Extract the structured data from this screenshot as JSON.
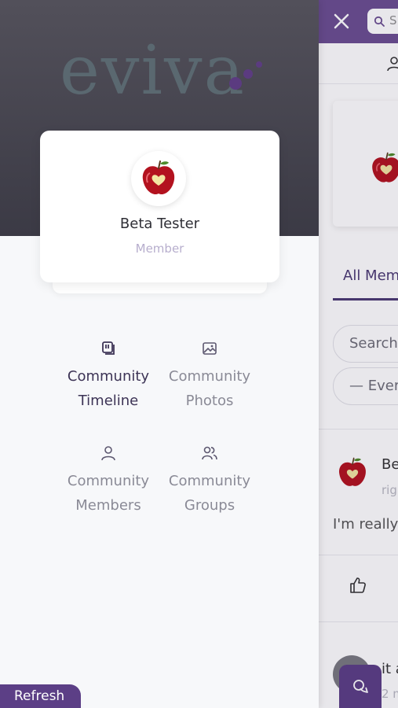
{
  "drawer": {
    "logo_text": "eviva",
    "profile": {
      "name": "Beta Tester",
      "role": "Member"
    },
    "menu": [
      {
        "label_line1": "Community",
        "label_line2": "Timeline",
        "icon": "timeline-icon",
        "active": true
      },
      {
        "label_line1": "Community",
        "label_line2": "Photos",
        "icon": "photos-icon",
        "active": false
      },
      {
        "label_line1": "Community",
        "label_line2": "Members",
        "icon": "person-icon",
        "active": false
      },
      {
        "label_line1": "Community",
        "label_line2": "Groups",
        "icon": "group-icon",
        "active": false
      }
    ],
    "refresh_label": "Refresh"
  },
  "background_page": {
    "search_placeholder": "S",
    "tabs": {
      "all_members": "All Mem"
    },
    "members_search_placeholder": "Search",
    "members_filter_value": "— Ever",
    "post": {
      "author": "Be",
      "time": "rig",
      "text": "I'm really"
    },
    "post2": {
      "line1": "it a",
      "line2": "2 m"
    }
  },
  "colors": {
    "brand_purple": "#6b4f91",
    "accent_dark": "#4b3a73",
    "button_purple": "#5c3f86",
    "header_gray": "#45444f"
  }
}
